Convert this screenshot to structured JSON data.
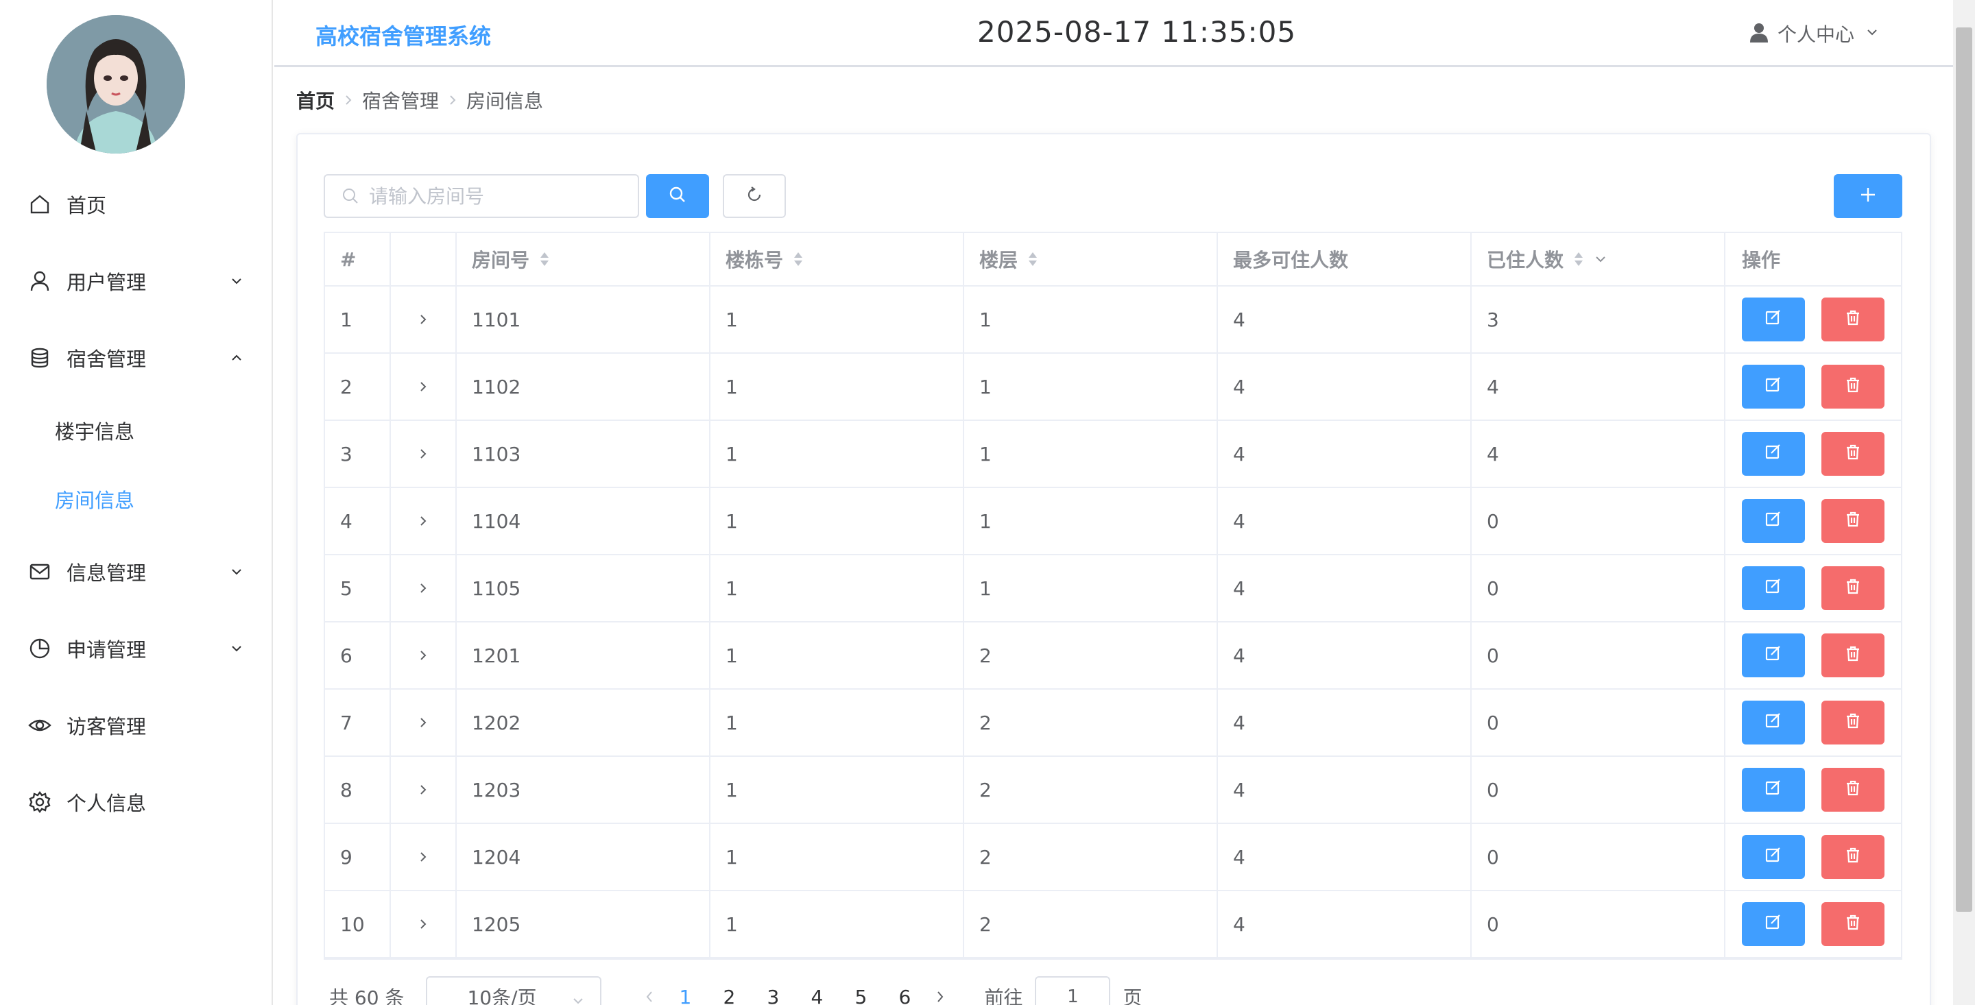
{
  "header": {
    "app_title": "高校宿舍管理系统",
    "datetime": "2025-08-17 11:35:05",
    "user_menu_label": "个人中心"
  },
  "sidebar": {
    "items": [
      {
        "label": "首页",
        "icon": "home-icon"
      },
      {
        "label": "用户管理",
        "icon": "user-icon",
        "expandable": true
      },
      {
        "label": "宿舍管理",
        "icon": "database-icon",
        "expandable": true,
        "expanded": true,
        "children": [
          {
            "label": "楼宇信息"
          },
          {
            "label": "房间信息",
            "active": true
          }
        ]
      },
      {
        "label": "信息管理",
        "icon": "mail-icon",
        "expandable": true
      },
      {
        "label": "申请管理",
        "icon": "pie-chart-icon",
        "expandable": true
      },
      {
        "label": "访客管理",
        "icon": "eye-icon"
      },
      {
        "label": "个人信息",
        "icon": "gear-icon"
      }
    ]
  },
  "breadcrumb": [
    "首页",
    "宿舍管理",
    "房间信息"
  ],
  "search": {
    "placeholder": "请输入房间号",
    "value": ""
  },
  "table": {
    "columns": [
      "#",
      "",
      "房间号",
      "楼栋号",
      "楼层",
      "最多可住人数",
      "已住人数",
      "操作"
    ],
    "rows": [
      {
        "index": "1",
        "room": "1101",
        "building": "1",
        "floor": "1",
        "max": "4",
        "current": "3"
      },
      {
        "index": "2",
        "room": "1102",
        "building": "1",
        "floor": "1",
        "max": "4",
        "current": "4"
      },
      {
        "index": "3",
        "room": "1103",
        "building": "1",
        "floor": "1",
        "max": "4",
        "current": "4"
      },
      {
        "index": "4",
        "room": "1104",
        "building": "1",
        "floor": "1",
        "max": "4",
        "current": "0"
      },
      {
        "index": "5",
        "room": "1105",
        "building": "1",
        "floor": "1",
        "max": "4",
        "current": "0"
      },
      {
        "index": "6",
        "room": "1201",
        "building": "1",
        "floor": "2",
        "max": "4",
        "current": "0"
      },
      {
        "index": "7",
        "room": "1202",
        "building": "1",
        "floor": "2",
        "max": "4",
        "current": "0"
      },
      {
        "index": "8",
        "room": "1203",
        "building": "1",
        "floor": "2",
        "max": "4",
        "current": "0"
      },
      {
        "index": "9",
        "room": "1204",
        "building": "1",
        "floor": "2",
        "max": "4",
        "current": "0"
      },
      {
        "index": "10",
        "room": "1205",
        "building": "1",
        "floor": "2",
        "max": "4",
        "current": "0"
      }
    ]
  },
  "pagination": {
    "total_text": "共 60 条",
    "page_size": "10条/页",
    "pages": [
      "1",
      "2",
      "3",
      "4",
      "5",
      "6"
    ],
    "current_page": "1",
    "goto_label": "前往",
    "goto_value": "1",
    "goto_suffix": "页"
  },
  "colors": {
    "primary": "#409eff",
    "danger": "#f56c6c",
    "text": "#303133"
  }
}
